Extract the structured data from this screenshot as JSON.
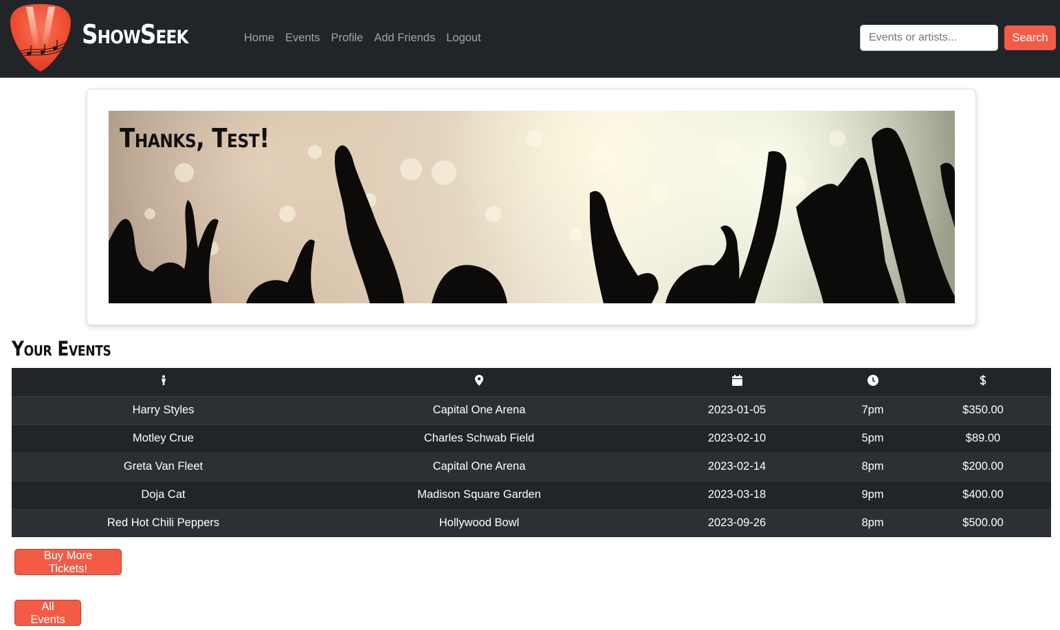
{
  "navbar": {
    "brand": "ShowSeek",
    "logo_icon": "guitar-pick-logo-icon",
    "links": [
      {
        "label": "Home"
      },
      {
        "label": "Events"
      },
      {
        "label": "Profile"
      },
      {
        "label": "Add Friends"
      },
      {
        "label": "Logout"
      }
    ],
    "search": {
      "placeholder": "Events or artists...",
      "value": "",
      "button_label": "Search"
    }
  },
  "hero": {
    "title": "Thanks, Test!",
    "image_icon": "concert-crowd-banner"
  },
  "events": {
    "title": "Your Events",
    "columns": [
      {
        "icon": "person-icon"
      },
      {
        "icon": "location-pin-icon"
      },
      {
        "icon": "calendar-icon"
      },
      {
        "icon": "clock-icon"
      },
      {
        "icon": "dollar-icon"
      }
    ],
    "rows": [
      {
        "artist": "Harry Styles",
        "venue": "Capital One Arena",
        "date": "2023-01-05",
        "time": "7pm",
        "price": "$350.00"
      },
      {
        "artist": "Motley Crue",
        "venue": "Charles Schwab Field",
        "date": "2023-02-10",
        "time": "5pm",
        "price": "$89.00"
      },
      {
        "artist": "Greta Van Fleet",
        "venue": "Capital One Arena",
        "date": "2023-02-14",
        "time": "8pm",
        "price": "$200.00"
      },
      {
        "artist": "Doja Cat",
        "venue": "Madison Square Garden",
        "date": "2023-03-18",
        "time": "9pm",
        "price": "$400.00"
      },
      {
        "artist": "Red Hot Chili Peppers",
        "venue": "Hollywood Bowl",
        "date": "2023-09-26",
        "time": "8pm",
        "price": "$500.00"
      }
    ]
  },
  "buttons": {
    "buy_more": "Buy More Tickets!",
    "all_events": "All Events"
  },
  "colors": {
    "navbar_bg": "#212529",
    "accent": "#f45b45",
    "table_bg": "#212529",
    "table_stripe": "#2c3034"
  }
}
